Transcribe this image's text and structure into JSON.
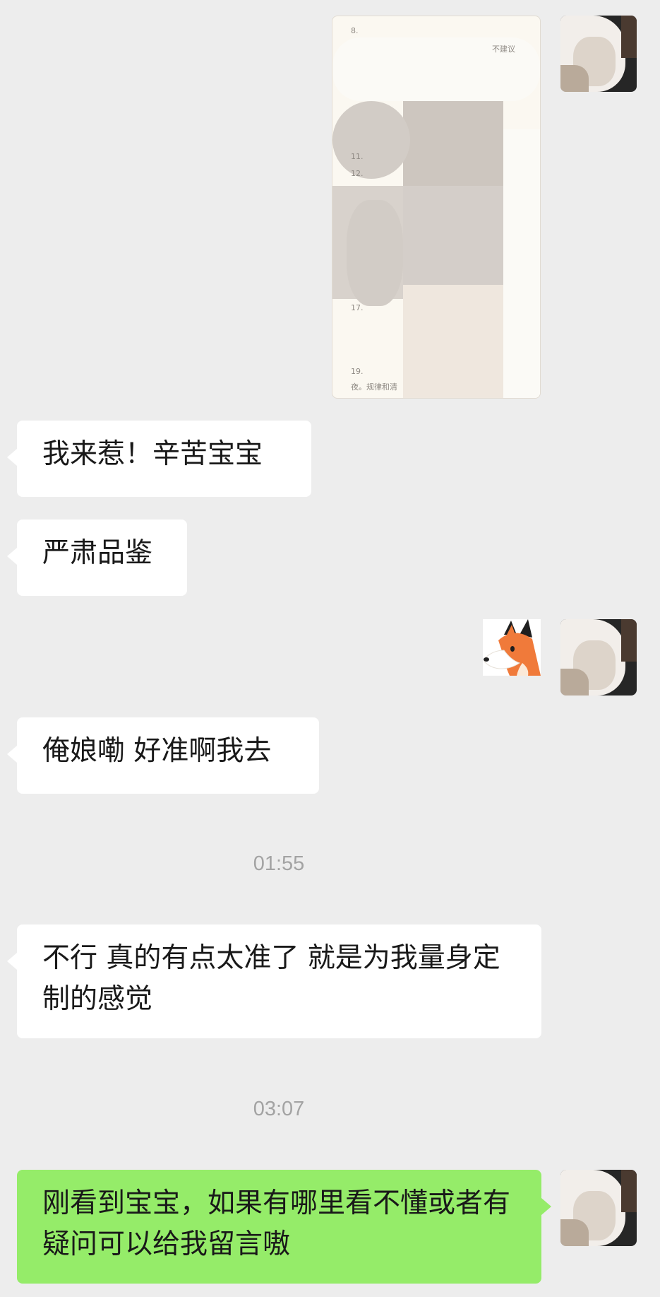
{
  "chat": {
    "messages": [
      {
        "text": "我来惹！辛苦宝宝"
      },
      {
        "text": "严肃品鉴"
      },
      {
        "text": "俺娘嘞 好准啊我去"
      },
      {
        "text": "不行 真的有点太准了 就是为我量身定制的感觉"
      },
      {
        "text": "刚看到宝宝，如果有哪里看不懂或者有疑问可以给我留言嗷"
      }
    ],
    "times": [
      "01:55",
      "03:07"
    ],
    "doc_fragments": [
      "8.",
      "不建议",
      "11.",
      "12.",
      "17.",
      "19.",
      "夜。规律和清"
    ]
  },
  "colors": {
    "background": "#ededed",
    "incoming_bubble": "#ffffff",
    "outgoing_bubble": "#95ec69",
    "timestamp": "#a3a3a3"
  }
}
